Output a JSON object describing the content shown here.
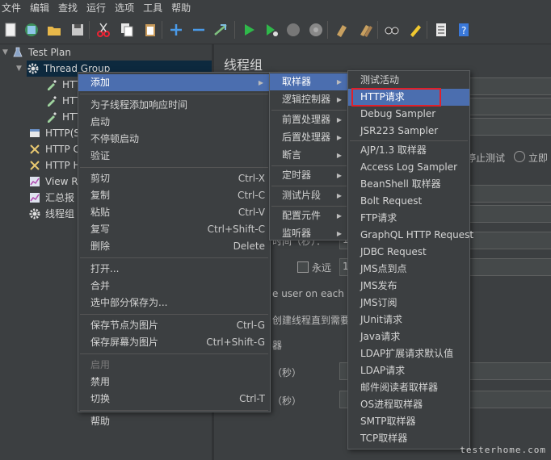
{
  "menubar": [
    "文件",
    "编辑",
    "查找",
    "运行",
    "选项",
    "工具",
    "帮助"
  ],
  "toolbar_icons": [
    "new-icon",
    "templates-icon",
    "open-icon",
    "save-icon",
    "cut-icon",
    "copy-icon",
    "paste-icon",
    "expand-icon",
    "collapse-icon",
    "toggle-icon",
    "start-icon",
    "start-no-pause-icon",
    "stop-icon",
    "shutdown-icon",
    "clear-icon",
    "clear-all-icon",
    "search-icon",
    "reset-search-icon",
    "function-helper-icon",
    "help-icon"
  ],
  "tree": {
    "test_plan": "Test Plan",
    "thread_group": "Thread Group",
    "http1": "HTT",
    "http2": "HTT",
    "http3": "HTT",
    "http_s": "HTTP(S",
    "http_c": "HTTP C",
    "http_h": "HTTP H",
    "view_r": "View Re",
    "summary": "汇总报",
    "thread_group2": "线程组"
  },
  "right": {
    "title": "线程组",
    "stop_test": "停止测试",
    "stop_now": "立即",
    "time_sec": "时间（秒）：",
    "forever": "永远",
    "one": "1",
    "one_b": "1",
    "user_each": "e user on each ite",
    "delay_create": "创建线程直到需要",
    "scheduler": "器",
    "duration": "（秒）",
    "startup": "（秒）"
  },
  "menu1": [
    {
      "label": "添加",
      "submenu": true,
      "highlight": true
    },
    {
      "sep": true
    },
    {
      "label": "为子线程添加响应时间"
    },
    {
      "label": "启动"
    },
    {
      "label": "不停顿启动"
    },
    {
      "label": "验证"
    },
    {
      "sep": true
    },
    {
      "label": "剪切",
      "shortcut": "Ctrl-X"
    },
    {
      "label": "复制",
      "shortcut": "Ctrl-C"
    },
    {
      "label": "粘贴",
      "shortcut": "Ctrl-V"
    },
    {
      "label": "复写",
      "shortcut": "Ctrl+Shift-C"
    },
    {
      "label": "删除",
      "shortcut": "Delete"
    },
    {
      "sep": true
    },
    {
      "label": "打开..."
    },
    {
      "label": "合并"
    },
    {
      "label": "选中部分保存为..."
    },
    {
      "sep": true
    },
    {
      "label": "保存节点为图片",
      "shortcut": "Ctrl-G"
    },
    {
      "label": "保存屏幕为图片",
      "shortcut": "Ctrl+Shift-G"
    },
    {
      "sep": true
    },
    {
      "label": "启用",
      "disabled": true
    },
    {
      "label": "禁用"
    },
    {
      "label": "切换",
      "shortcut": "Ctrl-T"
    },
    {
      "sep": true
    },
    {
      "label": "帮助"
    }
  ],
  "menu2": [
    {
      "label": "取样器",
      "highlight": true
    },
    {
      "label": "逻辑控制器"
    },
    {
      "sep": true
    },
    {
      "label": "前置处理器"
    },
    {
      "label": "后置处理器"
    },
    {
      "label": "断言"
    },
    {
      "sep": true
    },
    {
      "label": "定时器"
    },
    {
      "sep": true
    },
    {
      "label": "测试片段"
    },
    {
      "sep": true
    },
    {
      "label": "配置元件"
    },
    {
      "label": "监听器"
    }
  ],
  "menu3": [
    {
      "label": "测试活动"
    },
    {
      "label": "HTTP请求",
      "highlight": true,
      "boxed": true
    },
    {
      "label": "Debug Sampler"
    },
    {
      "label": "JSR223 Sampler"
    },
    {
      "sep": true
    },
    {
      "label": "AJP/1.3 取样器"
    },
    {
      "label": "Access Log Sampler"
    },
    {
      "label": "BeanShell 取样器"
    },
    {
      "label": "Bolt Request"
    },
    {
      "label": "FTP请求"
    },
    {
      "label": "GraphQL HTTP Request"
    },
    {
      "label": "JDBC Request"
    },
    {
      "label": "JMS点到点"
    },
    {
      "label": "JMS发布"
    },
    {
      "label": "JMS订阅"
    },
    {
      "label": "JUnit请求"
    },
    {
      "label": "Java请求"
    },
    {
      "label": "LDAP扩展请求默认值"
    },
    {
      "label": "LDAP请求"
    },
    {
      "label": "邮件阅读者取样器"
    },
    {
      "label": "OS进程取样器"
    },
    {
      "label": "SMTP取样器"
    },
    {
      "label": "TCP取样器"
    }
  ],
  "watermark": "testerhome.com",
  "colors": {
    "accent": "#4b6eaf",
    "highlight_box": "#e0202a",
    "bg": "#3c3f41"
  }
}
